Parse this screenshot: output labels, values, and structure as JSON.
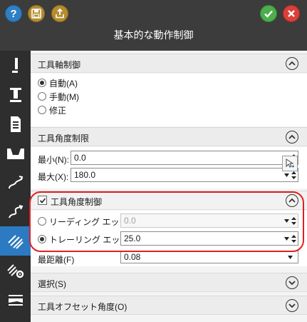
{
  "header": {
    "title": "基本的な動作制御",
    "help_glyph": "?",
    "colors": {
      "titlebar": "#3c3c3c",
      "ok": "#4cae4c",
      "cancel": "#d9413a",
      "help": "#2f7fc4"
    }
  },
  "toolbar_icons": [
    "tool-icon",
    "tool-holder-icon",
    "document-list-icon",
    "stock-shape-icon",
    "link-path-icon",
    "link-path-alt-icon",
    "multi-axis-pattern-icon",
    "pattern-settings-icon",
    "levels-icon"
  ],
  "sections": {
    "tool_axis_control": {
      "title": "工具軸制御",
      "options": [
        "自動(A)",
        "手動(M)",
        "修正"
      ],
      "selected": "自動(A)"
    },
    "tool_angle_limit": {
      "title": "工具角度制限",
      "min_label": "最小(N):",
      "min_value": "0.0",
      "max_label": "最大(X):",
      "max_value": "180.0"
    },
    "tool_angle_control": {
      "title": "工具角度制御",
      "checked": true,
      "leading_label": "リーディング エッジ(L):",
      "leading_value": "0.0",
      "trailing_label": "トレーリング エッジ(T):",
      "trailing_value": "25.0",
      "selected": "trailing",
      "partial_label": "最距離(F)",
      "partial_value": "0.08"
    },
    "selection": {
      "title": "選択(S)"
    },
    "tool_offset_angle": {
      "title": "工具オフセット角度(O)"
    }
  }
}
